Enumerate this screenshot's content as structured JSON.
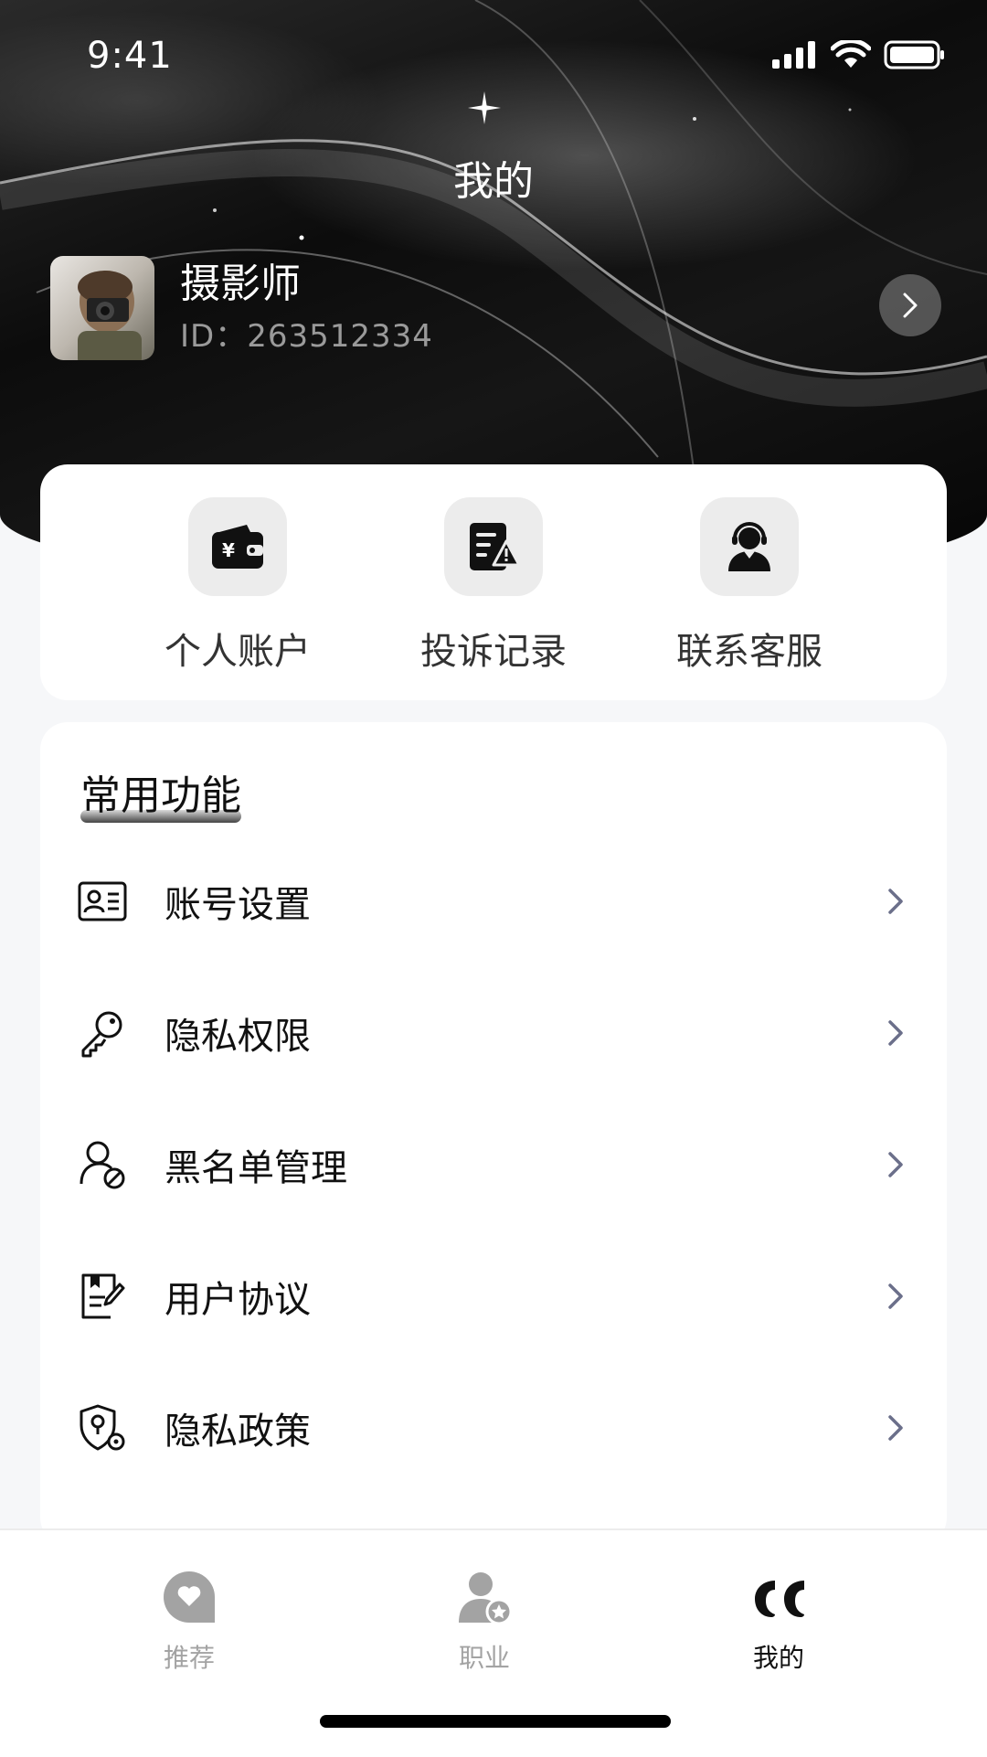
{
  "status_bar": {
    "time": "9:41"
  },
  "header": {
    "title": "我的"
  },
  "profile": {
    "name": "摄影师",
    "id_text": "ID：263512334"
  },
  "quick_actions": [
    {
      "label": "个人账户",
      "icon": "wallet-icon"
    },
    {
      "label": "投诉记录",
      "icon": "complaint-record-icon"
    },
    {
      "label": "联系客服",
      "icon": "customer-service-icon"
    }
  ],
  "functions": {
    "title": "常用功能",
    "items": [
      {
        "label": "账号设置",
        "icon": "id-card-icon"
      },
      {
        "label": "隐私权限",
        "icon": "key-icon"
      },
      {
        "label": "黑名单管理",
        "icon": "user-block-icon"
      },
      {
        "label": "用户协议",
        "icon": "agreement-icon"
      },
      {
        "label": "隐私政策",
        "icon": "privacy-shield-icon"
      }
    ]
  },
  "tabs": [
    {
      "label": "推荐",
      "icon": "heart-bubble-icon",
      "active": false
    },
    {
      "label": "职业",
      "icon": "user-star-icon",
      "active": false
    },
    {
      "label": "我的",
      "icon": "quote-icon",
      "active": true
    }
  ],
  "colors": {
    "chevron": "#6b6f8a",
    "active_tab": "#111111",
    "inactive_tab": "#a3a3a3"
  }
}
